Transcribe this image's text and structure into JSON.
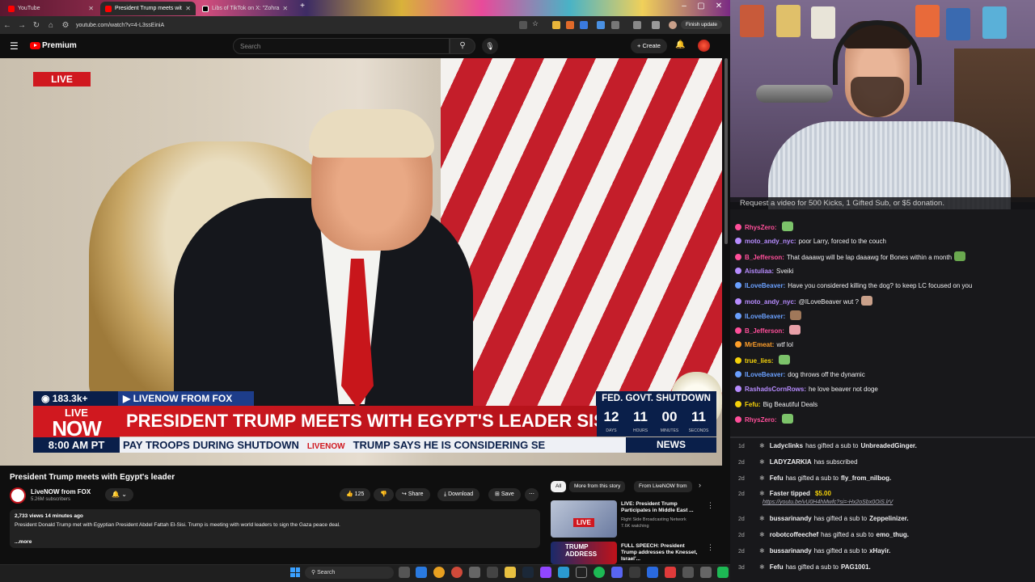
{
  "browser": {
    "tabs": [
      {
        "label": "YouTube",
        "active": false
      },
      {
        "label": "President Trump meets wit",
        "active": true
      },
      {
        "label": "Libs of TikTok on X: \"Zohra",
        "active": false
      }
    ],
    "url": "youtube.com/watch?v=4-L3ssEiniA",
    "finish_update": "Finish update"
  },
  "youtube": {
    "logo_text": "Premium",
    "search_placeholder": "Search",
    "create_label": "+ Create",
    "video": {
      "live_badge": "LIVE",
      "chyron": {
        "viewers": "◉ 183.3k+",
        "source": "▶ LIVENOW FROM FOX",
        "fed": "FED. GOVT. SHUTDOWN",
        "logo_top": "LIVE",
        "logo_bottom": "NOW",
        "headline": "PRESIDENT TRUMP MEETS WITH EGYPT'S LEADER SISI",
        "countdown": [
          {
            "num": "12",
            "label": "DAYS"
          },
          {
            "num": "11",
            "label": "HOURS"
          },
          {
            "num": "00",
            "label": "MINUTES"
          },
          {
            "num": "11",
            "label": "SECONDS"
          }
        ],
        "time": "8:00 AM PT",
        "ticker_left": "PAY TROOPS DURING SHUTDOWN",
        "ticker_mid": "LIVENOW",
        "ticker_right": "TRUMP SAYS HE IS CONSIDERING SE",
        "news": "NEWS"
      }
    },
    "title": "President Trump meets with Egypt's leader",
    "channel": {
      "name": "LiveNOW from FOX",
      "subs": "5.26M subscribers"
    },
    "actions": {
      "likes": "125",
      "share": "Share",
      "download": "Download",
      "save": "Save"
    },
    "description": {
      "meta": "2,733 views  14 minutes ago",
      "text": "President Donald Trump met with Egyptian President Abdel Fattah El-Sisi. Trump is meeting with world leaders to sign the Gaza peace deal.",
      "more": "...more"
    },
    "chips": [
      "All",
      "More from this story",
      "From LiveNOW from"
    ],
    "recommendations": [
      {
        "title": "LIVE: President Trump Participates in Middle East ...",
        "channel": "Right Side Broadcasting Network",
        "meta": "7.6K watching",
        "badge": "LIVE"
      },
      {
        "title": "FULL SPEECH: President Trump addresses the Knesset, Israel'...",
        "channel": "",
        "meta": "",
        "badge": "TRUMP ADDRESS"
      }
    ]
  },
  "stream": {
    "request_banner": "Request a video for 500 Kicks, 1 Gifted Sub, or $5 donation.",
    "chat": [
      {
        "user": "RhysZero:",
        "text": "",
        "color": "#ff4f9a",
        "emote": "#7cc36a"
      },
      {
        "user": "moto_andy_nyc:",
        "text": "poor Larry, forced to the couch",
        "color": "#b78cff",
        "emote": ""
      },
      {
        "user": "B_Jefferson:",
        "text": "That daaawg will be lap daaawg for Bones within a month",
        "color": "#ff4f9a",
        "emote": "#6aa84f"
      },
      {
        "user": "Aistuliaa:",
        "text": "Sveiki",
        "color": "#b78cff",
        "emote": ""
      },
      {
        "user": "ILoveBeaver:",
        "text": "Have you considered killing the dog? to keep LC focused on you",
        "color": "#6aa0ff",
        "emote": ""
      },
      {
        "user": "moto_andy_nyc:",
        "text": "@ILoveBeaver wut ?",
        "color": "#b78cff",
        "emote": "#c9a08a"
      },
      {
        "user": "ILoveBeaver:",
        "text": "",
        "color": "#6aa0ff",
        "emote": "#a0785a"
      },
      {
        "user": "B_Jefferson:",
        "text": "",
        "color": "#ff4f9a",
        "emote": "#e8a0a8"
      },
      {
        "user": "MrEmeat:",
        "text": "wtf lol",
        "color": "#ff9f2a",
        "emote": ""
      },
      {
        "user": "true_lies:",
        "text": "",
        "color": "#f5d20a",
        "emote": "#7cc36a"
      },
      {
        "user": "ILoveBeaver:",
        "text": "dog throws off the dynamic",
        "color": "#6aa0ff",
        "emote": ""
      },
      {
        "user": "RashadsCornRows:",
        "text": "he love beaver not doge",
        "color": "#b78cff",
        "emote": ""
      },
      {
        "user": "Fefu:",
        "text": "Big Beautiful Deals",
        "color": "#f5d20a",
        "emote": ""
      },
      {
        "user": "RhysZero:",
        "text": "",
        "color": "#ff4f9a",
        "emote": "#7cc36a"
      }
    ],
    "events": [
      {
        "age": "1d",
        "user": "Ladyclinks",
        "text": "has gifted a sub to",
        "target": "UnbreadedGinger."
      },
      {
        "age": "2d",
        "user": "LADYZARKIA",
        "text": "has subscribed",
        "target": ""
      },
      {
        "age": "2d",
        "user": "Fefu",
        "text": "has gifted a sub to",
        "target": "fly_from_nilbog."
      },
      {
        "age": "2d",
        "user": "Faster tipped",
        "text": "",
        "target": "$5.00"
      },
      {
        "age": "2d",
        "user": "bussarinandy",
        "text": "has gifted a sub to",
        "target": "Zeppelinizer."
      },
      {
        "age": "2d",
        "user": "robotcoffeechef",
        "text": "has gifted a sub to",
        "target": "emo_thug."
      },
      {
        "age": "2d",
        "user": "bussarinandy",
        "text": "has gifted a sub to",
        "target": "xHayir."
      },
      {
        "age": "3d",
        "user": "Fefu",
        "text": "has gifted a sub to",
        "target": "PAG1001."
      }
    ],
    "event_link": "https://youtu.be/vU0H4hMwfc?si=-Hx2oSbx0OiS.lrV"
  },
  "taskbar": {
    "search": "Search"
  },
  "colors": {
    "youtube_red": "#ff0000",
    "fox_red": "#d0181f",
    "fox_navy": "#0a1f4a",
    "chat_bg": "#18181b"
  }
}
